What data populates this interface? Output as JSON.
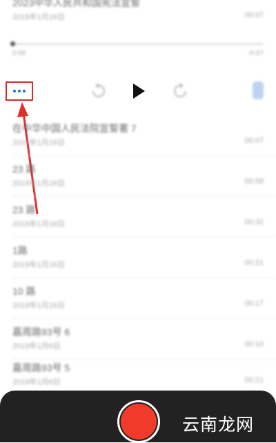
{
  "top_item": {
    "title": "2023中华人民共和国宪法宣誓",
    "date": "2019年1月16日",
    "duration": "00:07"
  },
  "player": {
    "elapsed": "0:00",
    "remaining": "-0:07",
    "progress": 0.0
  },
  "controls": {
    "more_icon": "more-dots-icon",
    "rewind_icon": "skip-back-15-icon",
    "play_icon": "play-icon",
    "forward_icon": "skip-forward-15-icon",
    "trash_icon": "trash-icon"
  },
  "recordings": [
    {
      "title": "在中华中国人民法院宣誓著 7",
      "date": "2019年1月16日",
      "duration": "00:07"
    },
    {
      "title": "23 路",
      "date": "2019年1月16日",
      "duration": "00:58"
    },
    {
      "title": "23 路",
      "date": "2019年1月16日",
      "duration": "00:32"
    },
    {
      "title": "1路",
      "date": "2019年1月16日",
      "duration": "00:21"
    },
    {
      "title": "10 路",
      "date": "2019年1月16日",
      "duration": "00:17"
    },
    {
      "title": "嘉周路93号 6",
      "date": "2019年1月6日",
      "duration": "00:10"
    },
    {
      "title": "嘉周路93号 5",
      "date": "2019年1月6日",
      "duration": "00:21"
    }
  ],
  "record_button": {
    "icon": "record-icon"
  },
  "watermark": "云南龙网",
  "colors": {
    "highlight": "#d42b2b",
    "accent": "#1a6ed8",
    "record": "#f03b2b",
    "bottom_bar": "#222222"
  }
}
